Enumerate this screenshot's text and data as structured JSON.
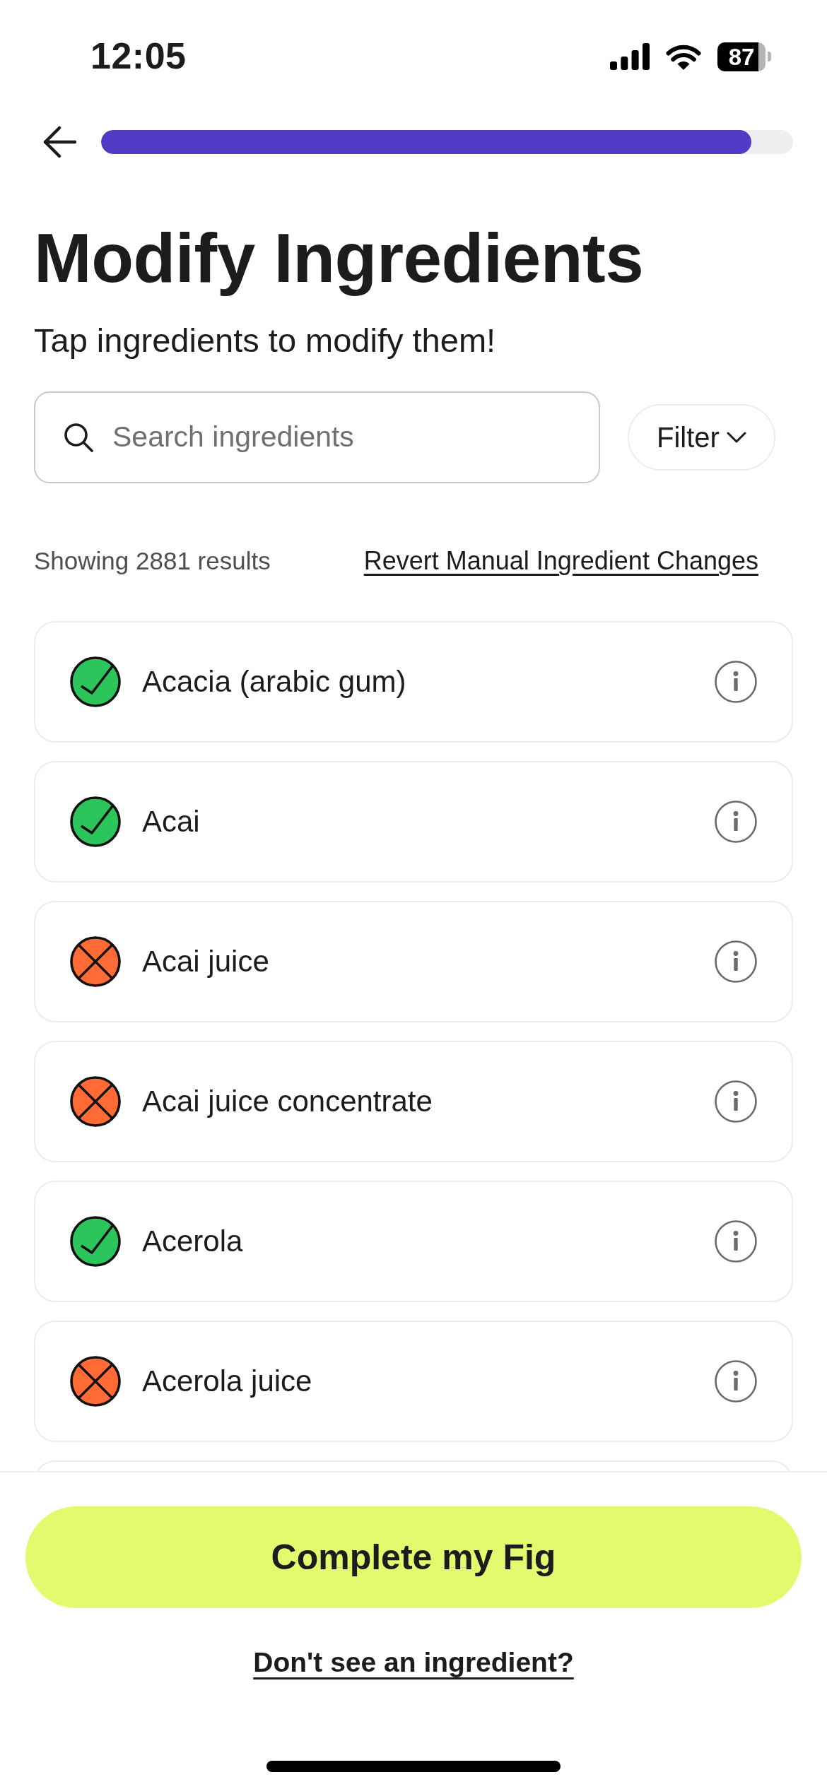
{
  "status_bar": {
    "time": "12:05",
    "battery": "87"
  },
  "header": {
    "progress": {
      "level": 0.94
    }
  },
  "title": "Modify Ingredients",
  "subtitle": "Tap ingredients to modify them!",
  "search": {
    "placeholder": "Search ingredients"
  },
  "filter_button": {
    "label": "Filter"
  },
  "results": {
    "summary": "Showing 2881 results",
    "revert_link": "Revert Manual Ingredient Changes"
  },
  "ingredients": [
    {
      "name": "Acacia (arabic gum)",
      "kind": "allowed"
    },
    {
      "name": "Acai",
      "kind": "allowed"
    },
    {
      "name": "Acai juice",
      "kind": "blocked"
    },
    {
      "name": "Acai juice concentrate",
      "kind": "blocked"
    },
    {
      "name": "Acerola",
      "kind": "allowed"
    },
    {
      "name": "Acerola juice",
      "kind": "blocked"
    }
  ],
  "footer": {
    "primary_button": "Complete my Fig",
    "secondary_link": "Don't see an ingredient?"
  }
}
